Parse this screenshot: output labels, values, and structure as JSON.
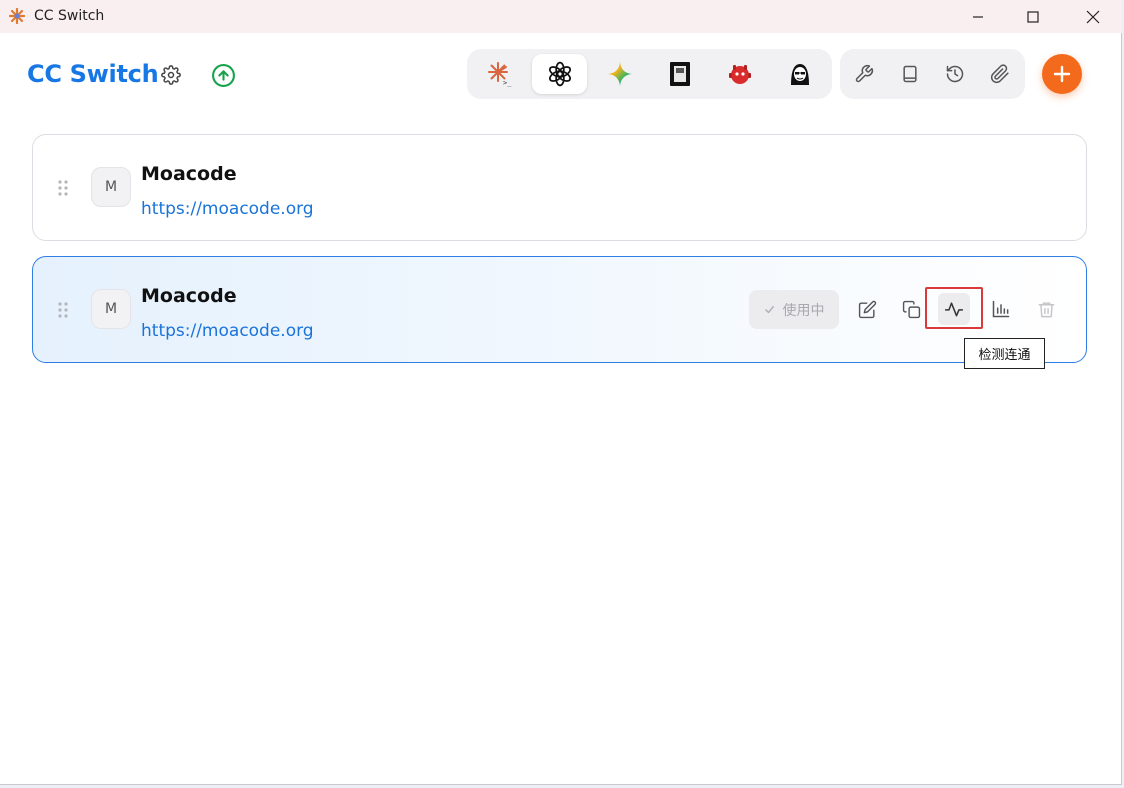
{
  "window": {
    "title": "CC Switch",
    "controls": [
      "minimize",
      "maximize",
      "close"
    ]
  },
  "header": {
    "brand": "CC Switch",
    "settings_icon": "gear-icon",
    "update_icon": "arrow-up-circle-icon",
    "app_tabs": [
      {
        "name": "claude",
        "icon": "claude-code-icon",
        "active": false
      },
      {
        "name": "codex",
        "icon": "openai-icon",
        "active": true
      },
      {
        "name": "gemini",
        "icon": "gemini-icon",
        "active": false
      },
      {
        "name": "terminal",
        "icon": "terminal-app-icon",
        "active": false
      },
      {
        "name": "red-bot",
        "icon": "red-bot-icon",
        "active": false
      },
      {
        "name": "avatar-agent",
        "icon": "agent-avatar-icon",
        "active": false
      }
    ],
    "tools": [
      {
        "name": "wrench",
        "icon": "wrench-icon"
      },
      {
        "name": "book",
        "icon": "book-icon"
      },
      {
        "name": "history",
        "icon": "history-icon"
      },
      {
        "name": "attachment",
        "icon": "paperclip-icon"
      }
    ],
    "add_icon": "plus-icon",
    "colors": {
      "brand": "#1677e5",
      "accent": "#f46a1c",
      "update": "#16a34a"
    }
  },
  "providers": [
    {
      "initial": "M",
      "name": "Moacode",
      "url": "https://moacode.org",
      "active": false
    },
    {
      "initial": "M",
      "name": "Moacode",
      "url": "https://moacode.org",
      "active": true,
      "in_use_label": "使用中",
      "actions": [
        "edit",
        "duplicate",
        "test-connection",
        "usage-stats",
        "delete"
      ]
    }
  ],
  "tooltip": {
    "text": "检测连通"
  }
}
